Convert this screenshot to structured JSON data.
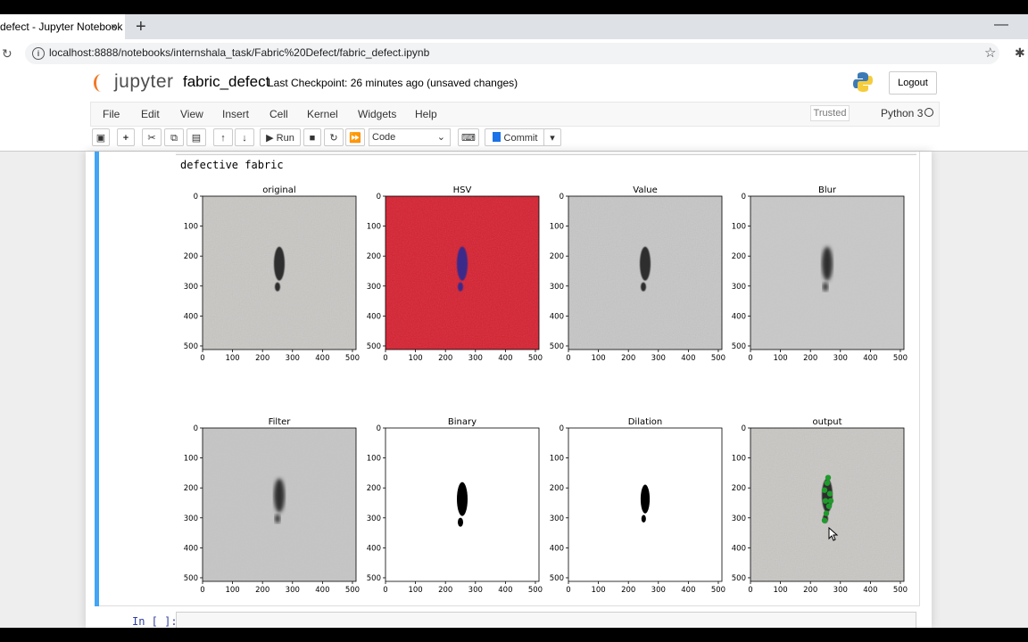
{
  "browser": {
    "tab_title": "defect - Jupyter Notebook",
    "tab_close": "×",
    "new_tab": "+",
    "minimize": "—",
    "url": "localhost:8888/notebooks/internshala_task/Fabric%20Defect/fabric_defect.ipynb"
  },
  "jupyter": {
    "logo_text": "jupyter",
    "notebook_name": "fabric_defect",
    "checkpoint": "Last Checkpoint: 26 minutes ago   (unsaved changes)",
    "logout_label": "Logout",
    "menu": [
      "File",
      "Edit",
      "View",
      "Insert",
      "Cell",
      "Kernel",
      "Widgets",
      "Help"
    ],
    "trusted_label": "Trusted",
    "kernel_name": "Python 3",
    "toolbar": {
      "run_label": "Run",
      "cell_type": "Code",
      "commit_label": "Commit"
    }
  },
  "cell": {
    "stdout": "defective fabric",
    "next_prompt": "In [ ]:"
  },
  "figure": {
    "panels": [
      {
        "title": "original",
        "kind": "fabric",
        "tint": "#c9c7c4",
        "blur": false
      },
      {
        "title": "HSV",
        "kind": "hsv",
        "tint": "#d61e2e",
        "blur": false
      },
      {
        "title": "Value",
        "kind": "fabric",
        "tint": "#c6c6c6",
        "blur": false
      },
      {
        "title": "Blur",
        "kind": "fabric",
        "tint": "#c8c8c8",
        "blur": true
      },
      {
        "title": "Filter",
        "kind": "fabric",
        "tint": "#c5c5c5",
        "blur": true
      },
      {
        "title": "Binary",
        "kind": "binary",
        "tint": "#ffffff",
        "blur": false
      },
      {
        "title": "Dilation",
        "kind": "binary",
        "tint": "#ffffff",
        "blur": false
      },
      {
        "title": "output",
        "kind": "output",
        "tint": "#c9c7c4",
        "blur": false
      }
    ],
    "x_ticks": [
      "0",
      "100",
      "200",
      "300",
      "400",
      "500"
    ],
    "y_ticks": [
      "0",
      "100",
      "200",
      "300",
      "400",
      "500"
    ]
  },
  "colors": {
    "cell_selected_bar": "#42a5f5",
    "jupyter_orange": "#f37726",
    "commit_blue": "#1a73e8"
  }
}
